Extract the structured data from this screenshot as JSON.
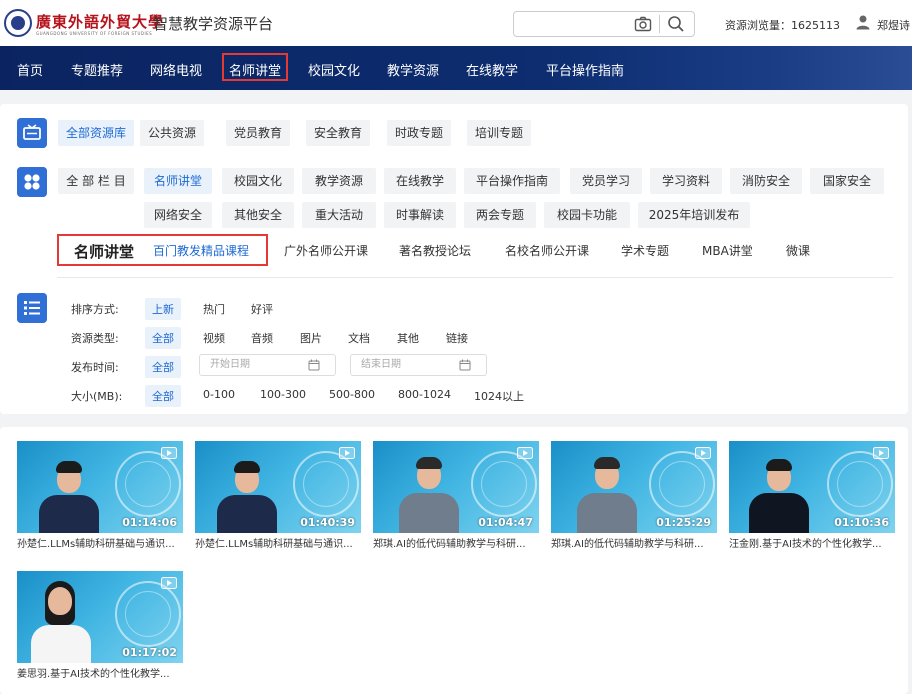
{
  "header": {
    "logo_cn": "廣東外語外貿大學",
    "logo_en": "GUANGDONG UNIVERSITY OF FOREIGN STUDIES",
    "platform_title": "智慧教学资源平台",
    "search_placeholder": "",
    "views_label": "资源浏览量：1625113",
    "user_name": "郑煜诗"
  },
  "nav": {
    "items": [
      "首页",
      "专题推荐",
      "网络电视",
      "名师讲堂",
      "校园文化",
      "教学资源",
      "在线教学",
      "平台操作指南"
    ],
    "active": "名师讲堂"
  },
  "filters": {
    "library_row": {
      "icon": "tv-icon",
      "items": [
        "全部资源库",
        "公共资源",
        "党员教育",
        "安全教育",
        "时政专题",
        "培训专题"
      ],
      "active": "全部资源库"
    },
    "column_row": {
      "icon": "grid-icon",
      "items": [
        "全 部 栏 目",
        "名师讲堂",
        "校园文化",
        "教学资源",
        "在线教学",
        "平台操作指南",
        "党员学习",
        "学习资料",
        "消防安全",
        "国家安全",
        "网络安全",
        "其他安全",
        "重大活动",
        "时事解读",
        "两会专题",
        "校园卡功能",
        "2025年培训发布"
      ],
      "active": "名师讲堂"
    },
    "sub_row": {
      "title": "名师讲堂",
      "items": [
        "百门教发精品课程",
        "广外名师公开课",
        "著名教授论坛",
        "名校名师公开课",
        "学术专题",
        "MBA讲堂",
        "微课"
      ],
      "active": "百门教发精品课程"
    },
    "options": {
      "icon": "list-icon",
      "sort": {
        "label": "排序方式:",
        "options": [
          "上新",
          "热门",
          "好评"
        ],
        "active": "上新"
      },
      "type": {
        "label": "资源类型:",
        "options": [
          "全部",
          "视频",
          "音频",
          "图片",
          "文档",
          "其他",
          "链接"
        ],
        "active": "全部"
      },
      "date": {
        "label": "发布时间:",
        "options": [
          "全部"
        ],
        "active": "全部",
        "start_placeholder": "开始日期",
        "end_placeholder": "结束日期"
      },
      "size": {
        "label": "大小(MB):",
        "options": [
          "全部",
          "0-100",
          "100-300",
          "500-800",
          "800-1024",
          "1024以上"
        ],
        "active": "全部"
      }
    }
  },
  "videos": [
    {
      "title": "孙楚仁.LLMs辅助科研基础与通识...",
      "duration": "01:14:06",
      "presenter": "male-suit"
    },
    {
      "title": "孙楚仁.LLMs辅助科研基础与通识...",
      "duration": "01:40:39",
      "presenter": "male-suit"
    },
    {
      "title": "郑琪.AI的低代码辅助教学与科研...",
      "duration": "01:04:47",
      "presenter": "male-shirt"
    },
    {
      "title": "郑琪.AI的低代码辅助教学与科研...",
      "duration": "01:25:29",
      "presenter": "male-shirt"
    },
    {
      "title": "汪金刚.基于AI技术的个性化教学...",
      "duration": "01:10:36",
      "presenter": "male-black-suit"
    },
    {
      "title": "姜思羽.基于AI技术的个性化教学...",
      "duration": "01:17:02",
      "presenter": "female-white"
    }
  ]
}
